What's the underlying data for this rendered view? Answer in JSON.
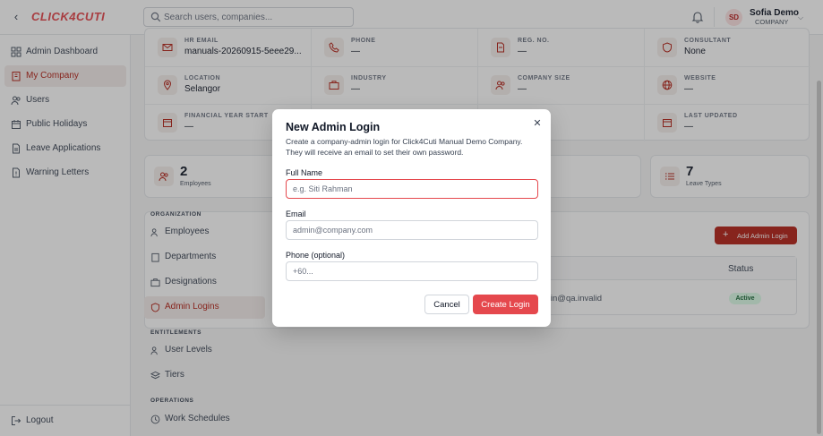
{
  "app": {
    "logo": "CLICK4CUTI",
    "brand_color": "#e5484d",
    "accent_color": "#b42318"
  },
  "search": {
    "placeholder": "Search users, companies..."
  },
  "user": {
    "initials": "SD",
    "name": "Sofia Demo",
    "role": "COMPANY"
  },
  "sidebar": {
    "items": [
      {
        "label": "Admin Dashboard",
        "icon": "grid-icon",
        "active": false
      },
      {
        "label": "My Company",
        "icon": "building-icon",
        "active": true
      },
      {
        "label": "Users",
        "icon": "users-icon",
        "active": false
      },
      {
        "label": "Public Holidays",
        "icon": "calendar-icon",
        "active": false
      },
      {
        "label": "Leave Applications",
        "icon": "document-icon",
        "active": false
      },
      {
        "label": "Warning Letters",
        "icon": "file-icon",
        "active": false
      }
    ],
    "logout": "Logout"
  },
  "company_info": {
    "row1": [
      {
        "label": "HR EMAIL",
        "value": "manuals-20260915-5eee29...",
        "icon": "mail-icon"
      },
      {
        "label": "PHONE",
        "value": "—",
        "icon": "phone-icon"
      },
      {
        "label": "REG. NO.",
        "value": "—",
        "icon": "document-icon"
      },
      {
        "label": "CONSULTANT",
        "value": "None",
        "icon": "shield-icon"
      }
    ],
    "row2": [
      {
        "label": "LOCATION",
        "value": "Selangor",
        "icon": "pin-icon"
      },
      {
        "label": "INDUSTRY",
        "value": "—",
        "icon": "briefcase-icon"
      },
      {
        "label": "COMPANY SIZE",
        "value": "—",
        "icon": "users-icon"
      },
      {
        "label": "WEBSITE",
        "value": "—",
        "icon": "globe-icon"
      }
    ],
    "row3": [
      {
        "label": "FINANCIAL YEAR START",
        "value": "—",
        "icon": "calendar-icon"
      },
      {
        "label": "LAST UPDATED",
        "value": "—",
        "icon": "calendar-icon"
      }
    ]
  },
  "stats": [
    {
      "value": "2",
      "label": "Employees",
      "icon": "users-icon"
    },
    {
      "value": "7",
      "label": "Leave Types",
      "icon": "list-icon"
    }
  ],
  "subnav": {
    "organization_head": "ORGANIZATION",
    "organization": [
      {
        "label": "Employees",
        "icon": "users-icon",
        "active": false
      },
      {
        "label": "Departments",
        "icon": "building-icon",
        "active": false
      },
      {
        "label": "Designations",
        "icon": "briefcase-icon",
        "active": false
      },
      {
        "label": "Admin Logins",
        "icon": "shield-icon",
        "active": true
      }
    ],
    "entitlements_head": "ENTITLEMENTS",
    "entitlements": [
      {
        "label": "User Levels",
        "icon": "users-icon"
      },
      {
        "label": "Tiers",
        "icon": "layers-icon"
      }
    ],
    "operations_head": "OPERATIONS",
    "operations": [
      {
        "label": "Work Schedules",
        "icon": "clock-icon"
      }
    ]
  },
  "admin_logins": {
    "add_button": "Add Admin Login",
    "status_header": "Status",
    "row_email_fragment": "min@qa.invalid",
    "row_status": "Active"
  },
  "modal": {
    "title": "New Admin Login",
    "description": "Create a company-admin login for Click4Cuti Manual Demo Company. They will receive an email to set their own password.",
    "full_name_label": "Full Name",
    "full_name_placeholder": "e.g. Siti Rahman",
    "email_label": "Email",
    "email_placeholder": "admin@company.com",
    "phone_label": "Phone (optional)",
    "phone_placeholder": "+60...",
    "cancel": "Cancel",
    "create": "Create Login"
  }
}
